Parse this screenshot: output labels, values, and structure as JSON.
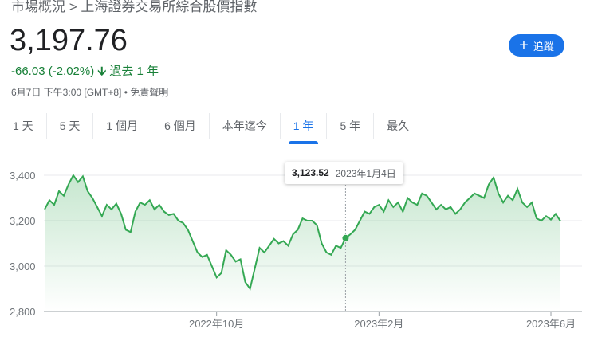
{
  "breadcrumb": "市場概況 > 上海證券交易所綜合股價指數",
  "price": "3,197.76",
  "change": "-66.03 (-2.02%)",
  "change_period": "過去 1 年",
  "meta": "6月7日 下午3:00 [GMT+8] • 免責聲明",
  "follow_label": "追蹤",
  "tabs": [
    "1 天",
    "5 天",
    "1 個月",
    "6 個月",
    "本年迄今",
    "1 年",
    "5 年",
    "最久"
  ],
  "active_tab": "1 年",
  "tooltip": {
    "value": "3,123.52",
    "date": "2023年1月4日"
  },
  "colors": {
    "line": "#34a853",
    "accent": "#1a73e8",
    "down": "#188038"
  },
  "chart_data": {
    "type": "area",
    "ylim": [
      2800,
      3400
    ],
    "yticks": [
      "3,400",
      "3,200",
      "3,000",
      "2,800"
    ],
    "ytick_values": [
      3400,
      3200,
      3000,
      2800
    ],
    "xticks": [
      {
        "label": "2022年10月",
        "index": 36
      },
      {
        "label": "2023年2月",
        "index": 70
      },
      {
        "label": "2023年6月",
        "index": 106
      }
    ],
    "hover_index": 63,
    "values": [
      3250,
      3290,
      3270,
      3330,
      3310,
      3360,
      3400,
      3370,
      3395,
      3330,
      3300,
      3260,
      3220,
      3270,
      3250,
      3275,
      3230,
      3160,
      3150,
      3240,
      3280,
      3270,
      3290,
      3250,
      3270,
      3240,
      3225,
      3230,
      3200,
      3190,
      3160,
      3110,
      3060,
      3040,
      3050,
      3000,
      2950,
      2970,
      3070,
      3050,
      3020,
      3030,
      2930,
      2900,
      2990,
      3080,
      3060,
      3090,
      3120,
      3100,
      3110,
      3090,
      3140,
      3160,
      3210,
      3200,
      3200,
      3180,
      3100,
      3060,
      3050,
      3090,
      3080,
      3123.52,
      3140,
      3160,
      3200,
      3240,
      3230,
      3260,
      3270,
      3240,
      3290,
      3260,
      3280,
      3240,
      3300,
      3280,
      3270,
      3320,
      3310,
      3280,
      3250,
      3270,
      3250,
      3260,
      3230,
      3250,
      3280,
      3300,
      3320,
      3310,
      3300,
      3360,
      3390,
      3320,
      3280,
      3310,
      3290,
      3340,
      3280,
      3260,
      3280,
      3210,
      3200,
      3220,
      3205,
      3230,
      3197.76
    ]
  }
}
